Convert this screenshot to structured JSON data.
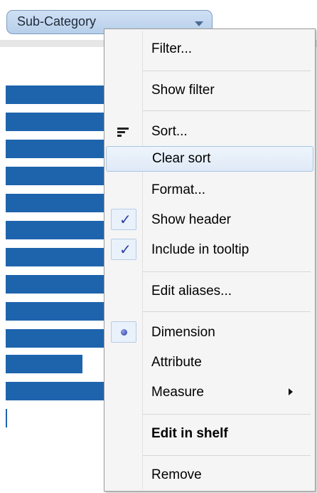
{
  "shelf": {
    "pill_label": "Sub-Category"
  },
  "bars": {
    "count": 12,
    "lengths": [
      0.98,
      0.98,
      0.98,
      0.98,
      0.98,
      0.98,
      0.98,
      0.98,
      0.98,
      0.98,
      0.41,
      0.98
    ]
  },
  "menu": {
    "items": [
      {
        "label": "Filter..."
      },
      {
        "label": "Show filter"
      },
      {
        "label": "Sort..."
      },
      {
        "label": "Clear sort"
      },
      {
        "label": "Format..."
      },
      {
        "label": "Show header",
        "checked": true
      },
      {
        "label": "Include in tooltip",
        "checked": true
      },
      {
        "label": "Edit aliases..."
      },
      {
        "label": "Dimension",
        "selected": true
      },
      {
        "label": "Attribute"
      },
      {
        "label": "Measure",
        "has_submenu": true
      },
      {
        "label": "Edit in shelf",
        "bold": true
      },
      {
        "label": "Remove"
      }
    ],
    "highlighted": "Clear sort",
    "colors": {
      "bar": "#1e64ad",
      "highlight": "#dfeaf7",
      "check": "#2e3fa3"
    }
  }
}
